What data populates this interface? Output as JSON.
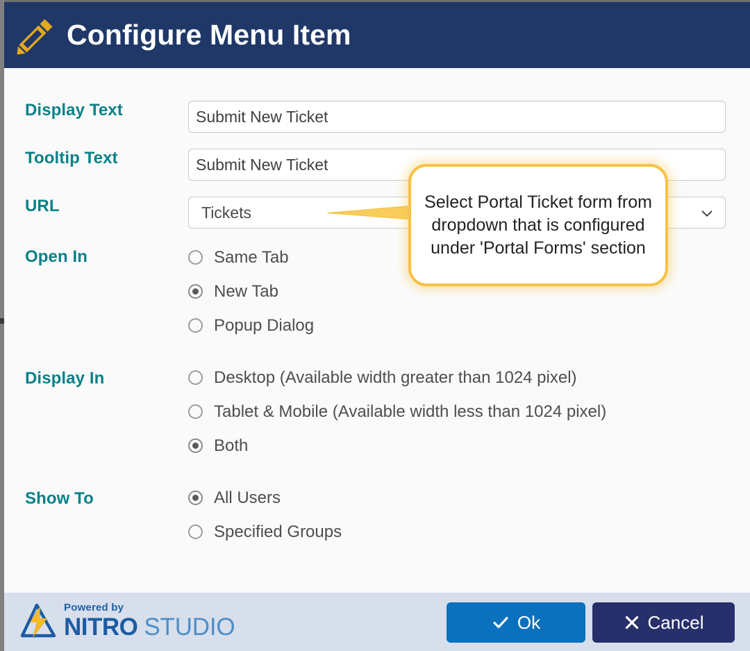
{
  "window": {
    "title": "Configure Menu Item",
    "title_icon": "pencil-icon",
    "header_bg": "#1f3868"
  },
  "form": {
    "fields": [
      {
        "label": "Display Text",
        "value": "Submit New Ticket",
        "type": "text"
      },
      {
        "label": "Tooltip Text",
        "value": "Submit New Ticket",
        "type": "text"
      },
      {
        "label": "URL",
        "value": "Tickets",
        "type": "select"
      }
    ],
    "groups": [
      {
        "label": "Open In",
        "options": [
          {
            "label": "Same Tab",
            "selected": false
          },
          {
            "label": "New Tab",
            "selected": true
          },
          {
            "label": "Popup Dialog",
            "selected": false
          }
        ]
      },
      {
        "label": "Display In",
        "options": [
          {
            "label": "Desktop (Available width greater than 1024 pixel)",
            "selected": false
          },
          {
            "label": "Tablet & Mobile (Available width less than 1024 pixel)",
            "selected": false
          },
          {
            "label": "Both",
            "selected": true
          }
        ]
      },
      {
        "label": "Show To",
        "options": [
          {
            "label": "All Users",
            "selected": true
          },
          {
            "label": "Specified Groups",
            "selected": false
          }
        ]
      }
    ],
    "label_color": "#0a8189"
  },
  "callout": {
    "text": "Select Portal Ticket form from dropdown that is configured under 'Portal Forms' section",
    "border_color": "#f6c244"
  },
  "footer": {
    "logo": {
      "powered_by": "Powered by",
      "brand_primary": "NITRO",
      "brand_secondary": "STUDIO",
      "mark_icon": "nitro-bolt-logo-icon"
    },
    "buttons": [
      {
        "label": "Ok",
        "icon": "check-icon",
        "color": "#0b71bd"
      },
      {
        "label": "Cancel",
        "icon": "close-icon",
        "color": "#27306b"
      }
    ],
    "bg": "#d7dfec"
  }
}
